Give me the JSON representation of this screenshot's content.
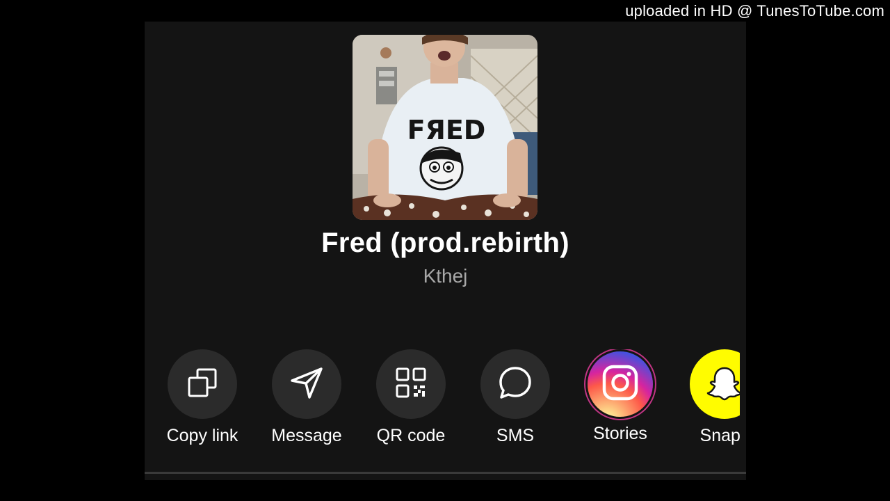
{
  "watermark": "uploaded in HD @ TunesToTube.com",
  "track": {
    "title": "Fred (prod.rebirth)",
    "artist": "Kthej",
    "cover_shirt_text": "FЯED"
  },
  "share_options": [
    {
      "label": "Copy link",
      "icon": "copy-icon"
    },
    {
      "label": "Message",
      "icon": "send-icon"
    },
    {
      "label": "QR code",
      "icon": "qr-code-icon"
    },
    {
      "label": "SMS",
      "icon": "chat-bubble-icon"
    },
    {
      "label": "Stories",
      "icon": "instagram-icon"
    },
    {
      "label": "Snapc",
      "icon": "snapchat-icon"
    }
  ],
  "colors": {
    "background": "#000000",
    "panel": "#141414",
    "button": "#2b2b2b",
    "snapchat": "#fffc00",
    "artist_text": "#a8a8a8"
  }
}
